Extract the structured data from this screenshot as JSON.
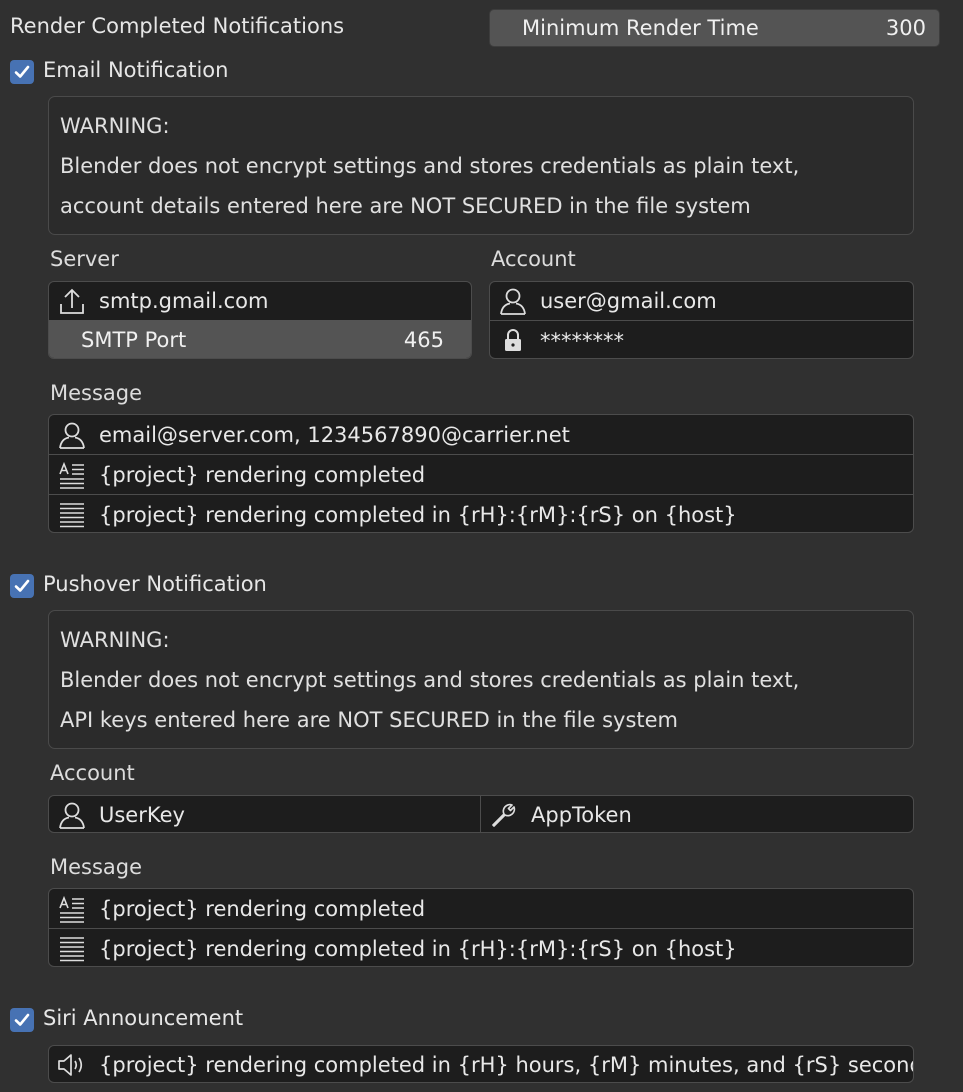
{
  "header": {
    "title": "Render Completed Notifications",
    "min_render_time_label": "Minimum Render Time",
    "min_render_time_value": "300"
  },
  "email": {
    "checkbox_label": "Email Notification",
    "checked": true,
    "warning": {
      "line1": "WARNING:",
      "line2": "Blender does not encrypt settings and stores credentials as plain text,",
      "line3": "account details entered here are NOT SECURED in the file system"
    },
    "server_label": "Server",
    "server_value": "smtp.gmail.com",
    "smtp_port_label": "SMTP Port",
    "smtp_port_value": "465",
    "account_label": "Account",
    "account_user": "user@gmail.com",
    "account_password": "********",
    "message_label": "Message",
    "recipients": "email@server.com, 1234567890@carrier.net",
    "subject": "{project} rendering completed",
    "body": "{project} rendering completed in {rH}:{rM}:{rS} on {host}"
  },
  "pushover": {
    "checkbox_label": "Pushover Notification",
    "checked": true,
    "warning": {
      "line1": "WARNING:",
      "line2": "Blender does not encrypt settings and stores credentials as plain text,",
      "line3": "API keys entered here are NOT SECURED in the file system"
    },
    "account_label": "Account",
    "user_key": "UserKey",
    "app_token": "AppToken",
    "message_label": "Message",
    "subject": "{project} rendering completed",
    "body": "{project} rendering completed in {rH}:{rM}:{rS} on {host}"
  },
  "siri": {
    "checkbox_label": "Siri Announcement",
    "checked": true,
    "message": "{project} rendering completed in {rH} hours, {rM} minutes, and {rS} seconds"
  },
  "colors": {
    "background": "#303030",
    "field": "#1d1d1d",
    "slider": "#545454",
    "checkbox": "#4772b3",
    "text": "#e6e6e6"
  },
  "icons": [
    "upload-icon",
    "user-icon",
    "lock-icon",
    "text-align-icon",
    "text-lines-icon",
    "wrench-icon",
    "speaker-icon",
    "check-icon"
  ]
}
